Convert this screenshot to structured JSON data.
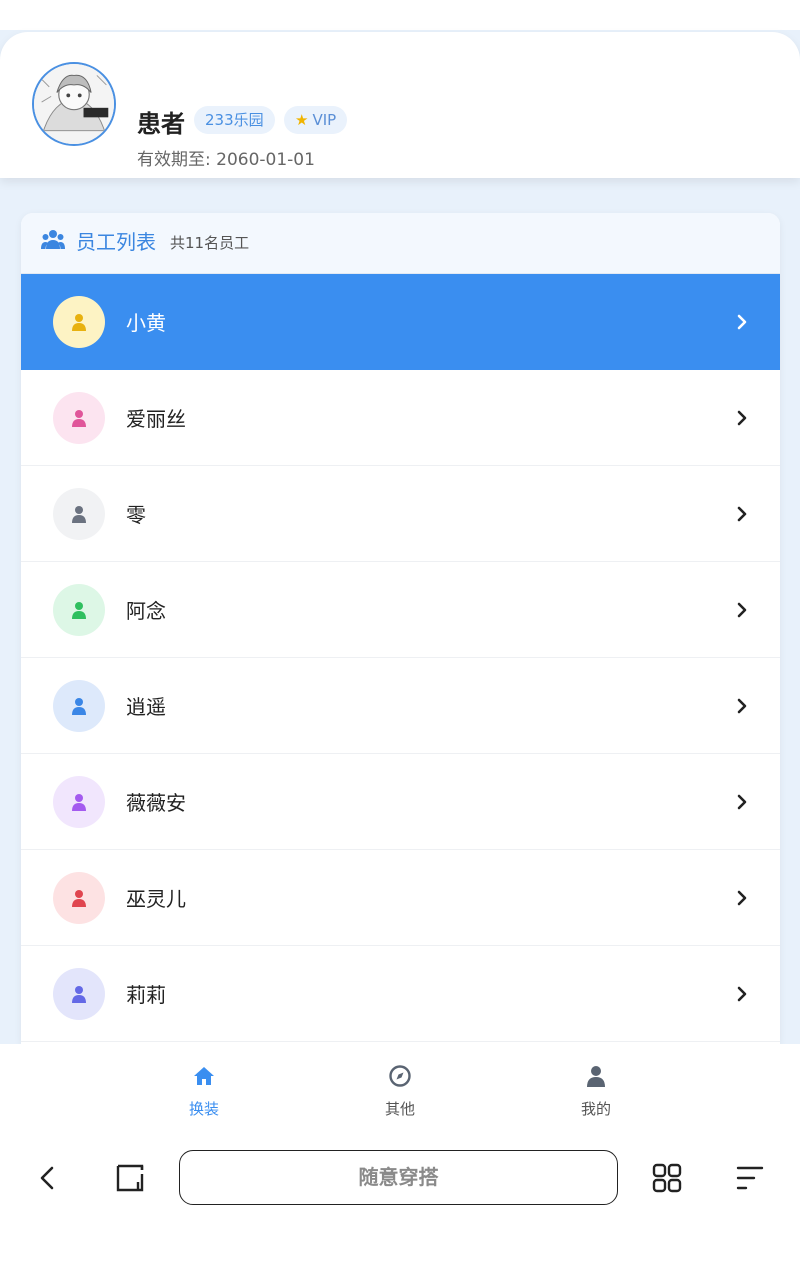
{
  "profile": {
    "name": "患者",
    "badge_park": "233乐园",
    "badge_vip": "VIP",
    "expiry": "有效期至: 2060-01-01"
  },
  "employees": {
    "title": "员工列表",
    "count": "共11名员工",
    "items": [
      {
        "name": "小黄",
        "color": "#e8b10f",
        "bg": "#fdf3c4",
        "active": true
      },
      {
        "name": "爱丽丝",
        "color": "#e0559a",
        "bg": "#fce4f0",
        "active": false
      },
      {
        "name": "零",
        "color": "#6b7280",
        "bg": "#f1f2f4",
        "active": false
      },
      {
        "name": "阿念",
        "color": "#2fbf5f",
        "bg": "#ddf7e6",
        "active": false
      },
      {
        "name": "逍遥",
        "color": "#3a86e6",
        "bg": "#dde9fb",
        "active": false
      },
      {
        "name": "薇薇安",
        "color": "#a45bef",
        "bg": "#f1e6fd",
        "active": false
      },
      {
        "name": "巫灵儿",
        "color": "#e0454f",
        "bg": "#fde2e3",
        "active": false
      },
      {
        "name": "莉莉",
        "color": "#6469e6",
        "bg": "#e3e5fb",
        "active": false
      }
    ]
  },
  "nav": {
    "items": [
      {
        "label": "换装",
        "icon": "home-icon"
      },
      {
        "label": "其他",
        "icon": "compass-icon"
      },
      {
        "label": "我的",
        "icon": "user-icon"
      }
    ]
  },
  "browser": {
    "title": "随意穿搭"
  },
  "colors": {
    "accent": "#3a8ef0",
    "background": "#e8f1fb"
  }
}
